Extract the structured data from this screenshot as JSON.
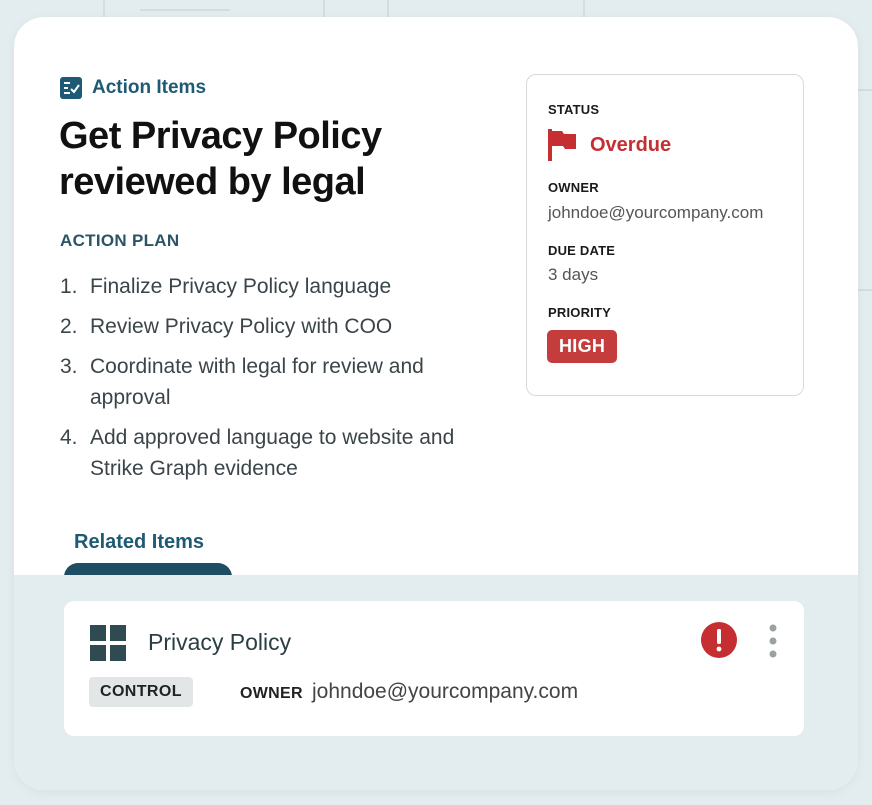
{
  "header": {
    "section_label": "Action Items",
    "section_icon": "checklist-icon",
    "title": "Get Privacy Policy reviewed by legal"
  },
  "action_plan": {
    "heading": "ACTION PLAN",
    "steps": [
      {
        "num": "1.",
        "text": "Finalize Privacy Policy language"
      },
      {
        "num": "2.",
        "text": "Review Privacy Policy with COO"
      },
      {
        "num": "3.",
        "text": "Coordinate with legal for review and approval"
      },
      {
        "num": "4.",
        "text": "Add approved language to website and Strike Graph evidence"
      }
    ]
  },
  "details": {
    "status_label": "STATUS",
    "status_value": "Overdue",
    "status_icon": "flag-icon",
    "owner_label": "OWNER",
    "owner_value": "johndoe@yourcompany.com",
    "due_label": "DUE DATE",
    "due_value": "3 days",
    "priority_label": "PRIORITY",
    "priority_value": "HIGH"
  },
  "related": {
    "tab_label": "Related Items",
    "items": [
      {
        "icon": "grid-icon",
        "name": "Privacy Policy",
        "type": "CONTROL",
        "owner_label": "OWNER",
        "owner_value": "johndoe@yourcompany.com",
        "alert_icon": "alert-icon",
        "menu_icon": "more-vertical-icon"
      }
    ]
  },
  "colors": {
    "brand_blue": "#1f5a74",
    "danger_red": "#c62f32",
    "badge_red": "#c53c3c",
    "panel_bg": "#e3ecee"
  }
}
